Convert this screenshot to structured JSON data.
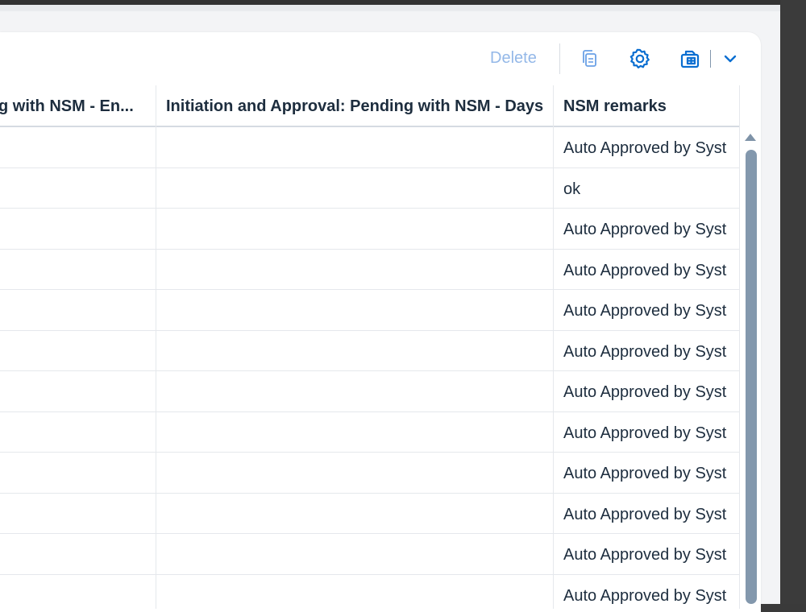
{
  "toolbar": {
    "delete_label": "Delete",
    "icons": [
      "copy-icon",
      "settings-icon",
      "export-icon",
      "chevron-down-icon"
    ],
    "accent_color": "#0a6ed1",
    "disabled_color": "#94b8e8"
  },
  "table": {
    "columns": [
      "Initiation and Approval: Pending with NSM - En...",
      "Initiation and Approval: Pending with NSM - Days",
      "NSM remarks"
    ],
    "visible_column_text": [
      "g with NSM - En...",
      "Initiation and Approval: Pending with NSM - Days",
      "NSM remarks"
    ],
    "rows": [
      {
        "col1": "",
        "col2": "",
        "remarks": "Auto Approved by Syst"
      },
      {
        "col1": "",
        "col2": "",
        "remarks": "ok"
      },
      {
        "col1": "",
        "col2": "",
        "remarks": "Auto Approved by Syst"
      },
      {
        "col1": "",
        "col2": "",
        "remarks": "Auto Approved by Syst"
      },
      {
        "col1": "",
        "col2": "",
        "remarks": "Auto Approved by Syst"
      },
      {
        "col1": "",
        "col2": "",
        "remarks": "Auto Approved by Syst"
      },
      {
        "col1": "",
        "col2": "",
        "remarks": "Auto Approved by Syst"
      },
      {
        "col1": "",
        "col2": "",
        "remarks": "Auto Approved by Syst"
      },
      {
        "col1": "",
        "col2": "",
        "remarks": "Auto Approved by Syst"
      },
      {
        "col1": "",
        "col2": "",
        "remarks": "Auto Approved by Syst"
      },
      {
        "col1": "",
        "col2": "",
        "remarks": "Auto Approved by Syst"
      },
      {
        "col1": "",
        "col2": "",
        "remarks": "Auto Approved by Syst"
      }
    ]
  }
}
